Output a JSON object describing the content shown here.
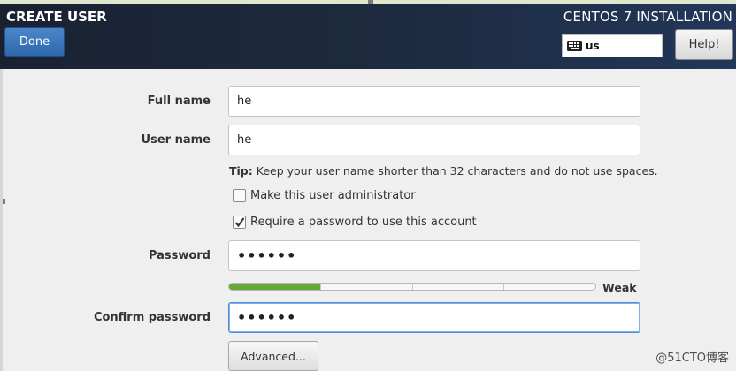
{
  "header": {
    "spoke_title": "CREATE USER",
    "done_label": "Done",
    "install_title": "CENTOS 7 INSTALLATION",
    "keyboard_layout": "us",
    "help_label": "Help!"
  },
  "form": {
    "full_name_label": "Full name",
    "full_name_value": "he",
    "user_name_label": "User name",
    "user_name_value": "he",
    "tip_prefix": "Tip:",
    "tip_text": " Keep your user name shorter than 32 characters and do not use spaces.",
    "admin_checkbox_label": "Make this user administrator",
    "admin_checked": false,
    "require_pw_label": "Require a password to use this account",
    "require_pw_checked": true,
    "password_label": "Password",
    "password_value": "••••••",
    "strength_label": "Weak",
    "strength_level": 0.25,
    "confirm_label": "Confirm password",
    "confirm_value": "••••••",
    "advanced_label": "Advanced..."
  },
  "watermark": "@51CTO博客",
  "colors": {
    "header_bg": "#1d2b40",
    "accent_blue": "#3a78bf",
    "strength_fill": "#67a73a"
  }
}
